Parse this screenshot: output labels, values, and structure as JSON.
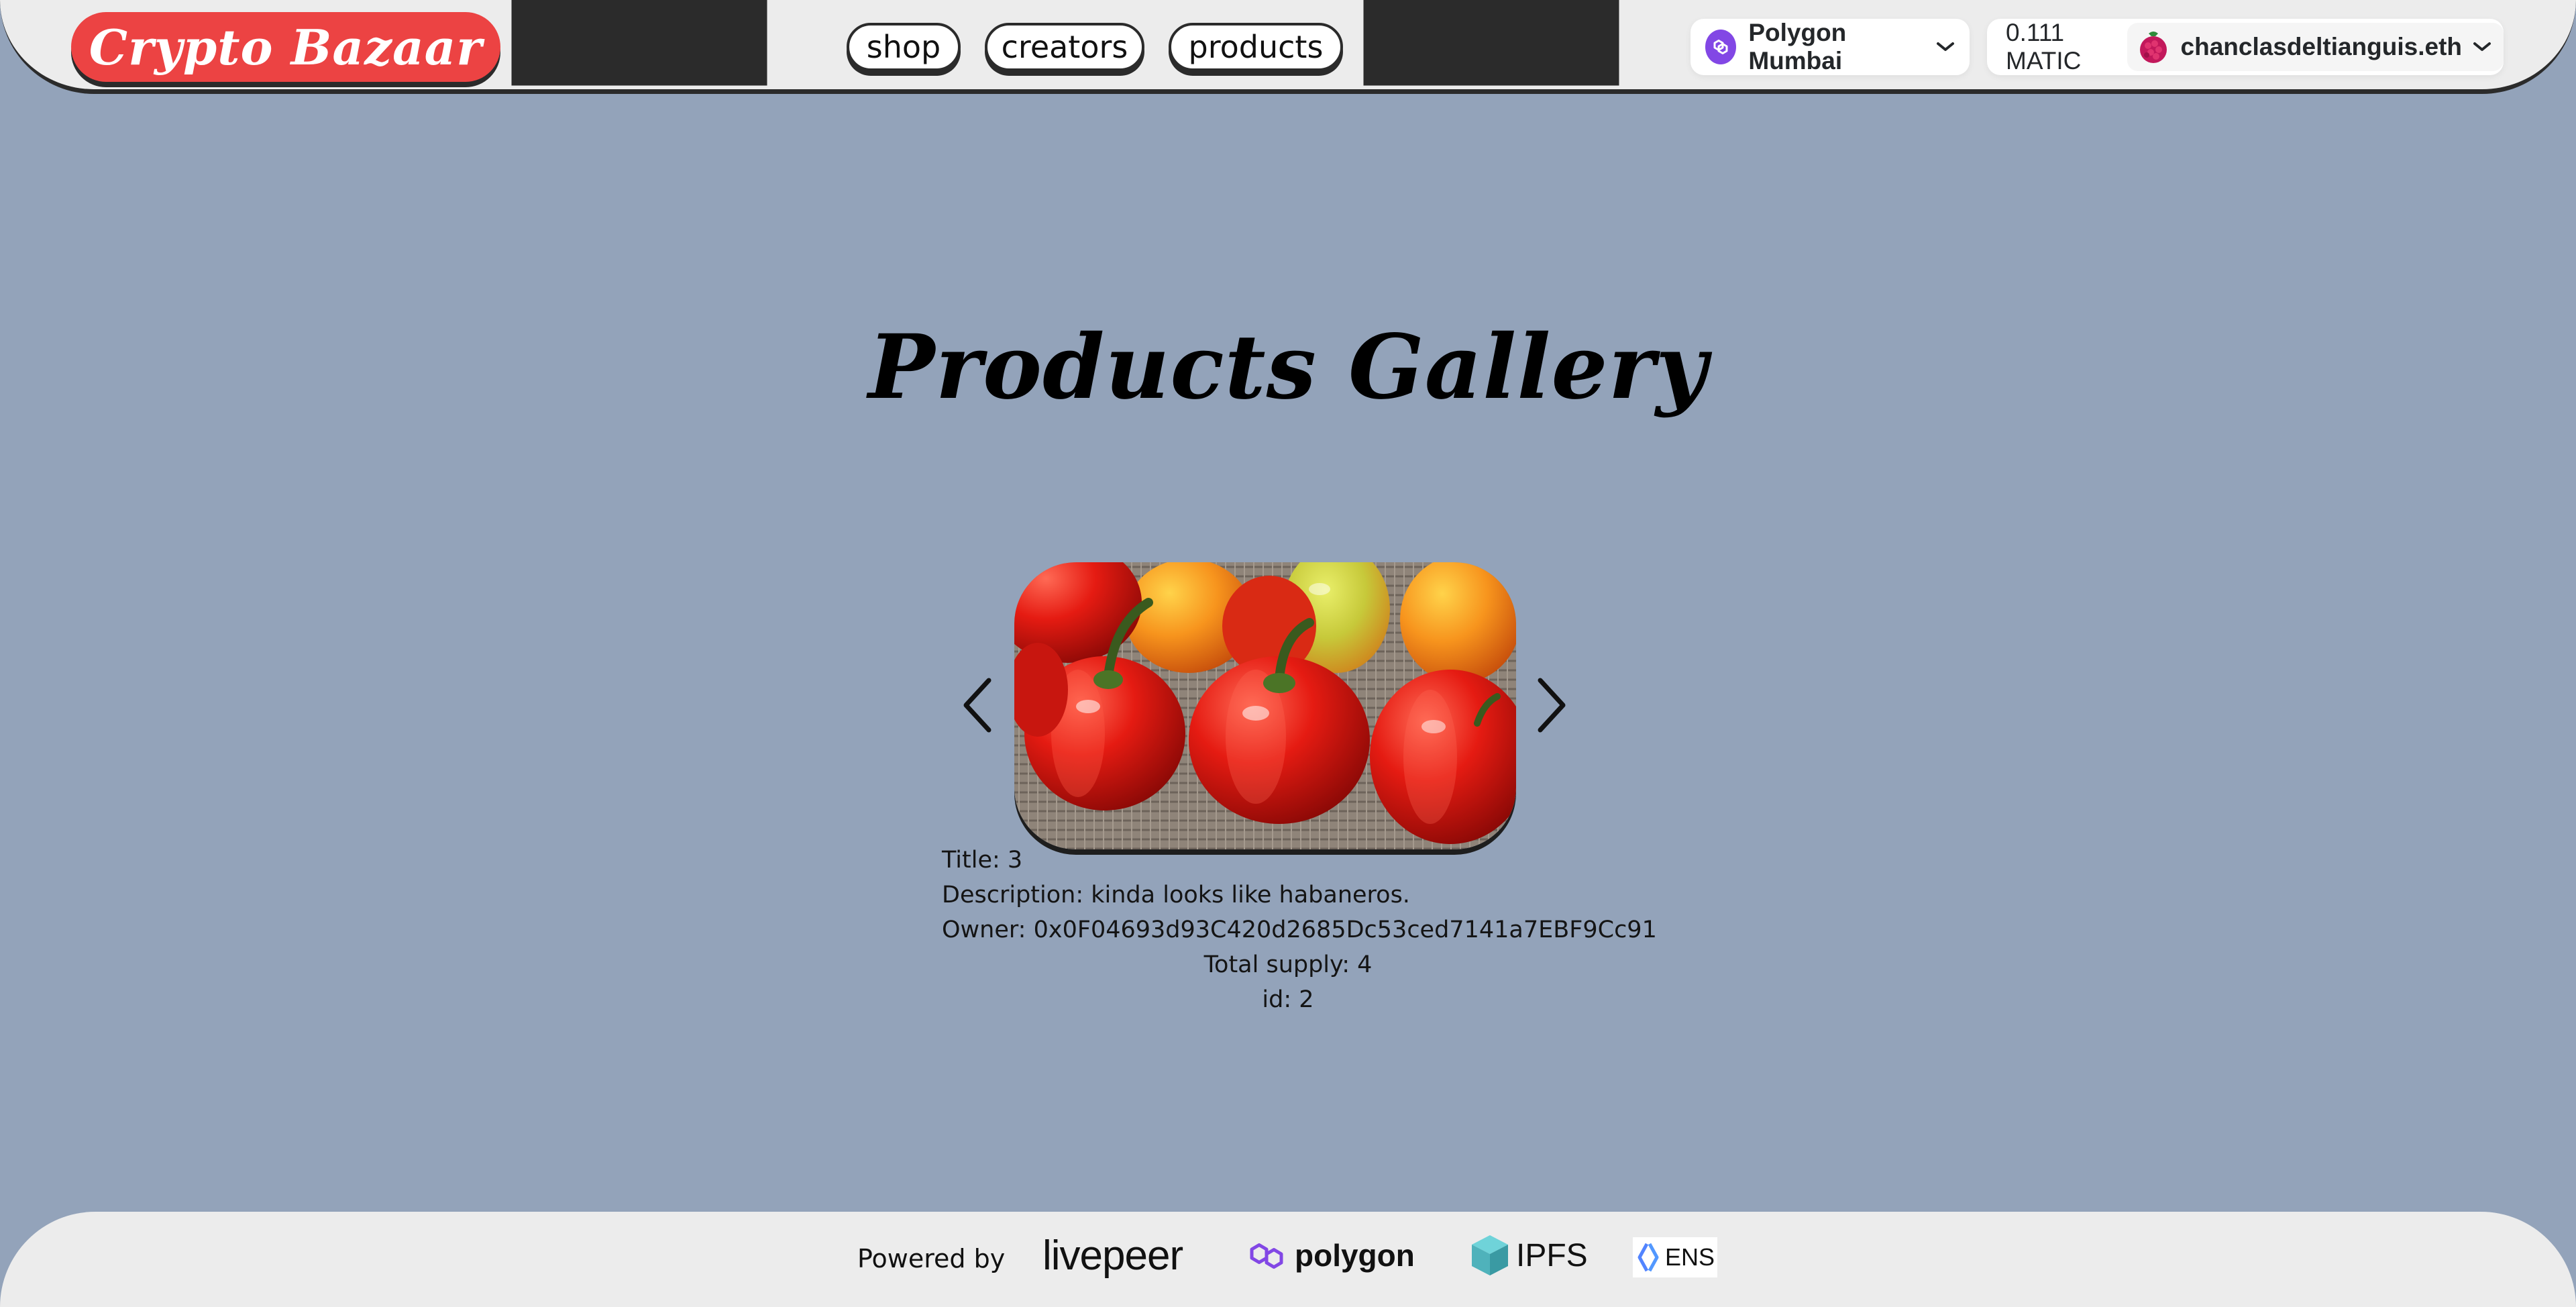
{
  "header": {
    "logo_text": "Crypto Bazaar",
    "nav": [
      {
        "label": "shop"
      },
      {
        "label": "creators"
      },
      {
        "label": "products"
      }
    ],
    "network": {
      "label": "Polygon Mumbai",
      "icon": "polygon-icon"
    },
    "account": {
      "balance": "0.111 MATIC",
      "name": "chanclasdeltianguis.eth",
      "avatar_icon": "raspberry-avatar-icon"
    }
  },
  "main": {
    "title": "Products Gallery",
    "carousel": {
      "prev_icon": "chevron-left-icon",
      "next_icon": "chevron-right-icon",
      "image": "habanero-peppers-photo"
    },
    "product": {
      "title": "Title: 3",
      "description": "Description: kinda looks like habaneros.",
      "owner": "Owner: 0x0F04693d93C420d2685Dc53ced7141a7EBF9Cc91",
      "total_supply": "Total supply: 4",
      "id": "id: 2"
    }
  },
  "footer": {
    "powered_by": "Powered by",
    "partners": [
      {
        "name": "livepeer"
      },
      {
        "name": "polygon"
      },
      {
        "name": "IPFS"
      },
      {
        "name": "ENS"
      }
    ]
  },
  "colors": {
    "background": "#93a3ba",
    "header_bg": "#ececec",
    "logo_red": "#ec4343",
    "polygon_purple": "#8247e5",
    "ipfs_teal": "#65c2cb"
  }
}
